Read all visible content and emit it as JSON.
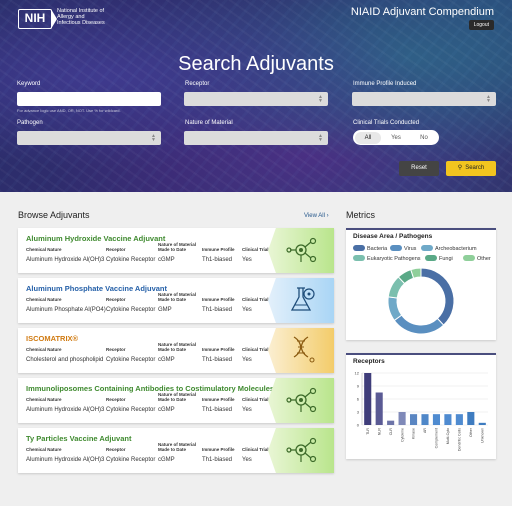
{
  "header": {
    "org_logo": "NIH",
    "org_name_lines": [
      "National Institute of",
      "Allergy and",
      "Infectious Diseases"
    ],
    "app_title": "NIAID Adjuvant Compendium",
    "logout_label": "Logout"
  },
  "search": {
    "title": "Search Adjuvants",
    "keyword_label": "Keyword",
    "keyword_value": "",
    "keyword_hint": "For advance logic use AND, OR, NOT. Use % for wildcard.",
    "receptor_label": "Receptor",
    "immune_label": "Immune Profile Induced",
    "pathogen_label": "Pathogen",
    "material_label": "Nature of Material",
    "trials_label": "Clinical Trials Conducted",
    "trials_options": [
      "All",
      "Yes",
      "No"
    ],
    "trials_selected": "All",
    "reset_label": "Reset",
    "search_label": "Search"
  },
  "browse": {
    "title": "Browse Adjuvants",
    "view_all": "View All",
    "field_labels": {
      "chemical": "Chemical Nature",
      "receptor": "Receptor",
      "material": "Nature of Material Made to Date",
      "immune": "Immune Profile",
      "trials": "Clinical Trials"
    },
    "cards": [
      {
        "name": "Aluminum Hydroxide Vaccine Adjuvant",
        "chemical": "Aluminum Hydroxide Al(OH)3",
        "receptor": "Cytokine Receptor",
        "material": "cGMP",
        "immune": "Th1-biased",
        "trials": "Yes",
        "theme": "green",
        "icon": "molecule-icon"
      },
      {
        "name": "Aluminum Phosphate Vaccine Adjuvant",
        "chemical": "Aluminum Phosphate Al(PO4)",
        "receptor": "Cytokine Receptor",
        "material": "GMP",
        "immune": "Th1-biased",
        "trials": "Yes",
        "theme": "blue",
        "icon": "flask-icon"
      },
      {
        "name": "ISCOMATRIX®",
        "chemical": "Cholesterol and phospholipid",
        "receptor": "Cytokine Receptor",
        "material": "cGMP",
        "immune": "Th1-biased",
        "trials": "Yes",
        "theme": "orange",
        "icon": "dna-icon"
      },
      {
        "name": "Immunoliposomes Containing Antibodies to Costimulatory Molecules",
        "chemical": "Aluminum Hydroxide Al(OH)3",
        "receptor": "Cytokine Receptor",
        "material": "cGMP",
        "immune": "Th1-biased",
        "trials": "Yes",
        "theme": "green",
        "icon": "molecule-icon"
      },
      {
        "name": "Ty Particles Vaccine Adjuvant",
        "chemical": "Aluminum Hydroxide Al(OH)3",
        "receptor": "Cytokine Receptor",
        "material": "cGMP",
        "immune": "Th1-biased",
        "trials": "Yes",
        "theme": "green",
        "icon": "molecule-icon"
      }
    ]
  },
  "metrics": {
    "title": "Metrics"
  },
  "chart_data": [
    {
      "type": "pie",
      "title": "Disease Area / Pathogens",
      "donut": true,
      "categories": [
        "Bacteria",
        "Virus",
        "Archeobacterium",
        "Eukaryotic Pathogens",
        "Fungi",
        "Other"
      ],
      "values": [
        38,
        27,
        12,
        11,
        7,
        5
      ],
      "colors": [
        "#4a6fa5",
        "#5a8fc0",
        "#6fa9c8",
        "#7bbfae",
        "#5aa987",
        "#8fcf9a"
      ],
      "legend_position": "top"
    },
    {
      "type": "bar",
      "title": "Receptors",
      "categories": [
        "TLR",
        "NLR",
        "CLR",
        "Cytokine",
        "Kinase",
        "AR",
        "Complement",
        "Multi-Cyto",
        "Dendritic Cells",
        "Other",
        "Unknown"
      ],
      "values": [
        12,
        7.5,
        1,
        3,
        2.5,
        2.5,
        2.5,
        2.5,
        2.5,
        3,
        0.5
      ],
      "colors": [
        "#3f3d7a",
        "#5a5a94",
        "#6d74a8",
        "#7f89b8",
        "#5a86c2",
        "#4f87c8",
        "#4f8bd0",
        "#4f8bd0",
        "#4f8bd0",
        "#3e7cc0",
        "#3e7cc0"
      ],
      "ylim": [
        0,
        12
      ],
      "yticks": [
        0,
        3,
        6,
        9,
        12
      ],
      "grid": true
    }
  ]
}
